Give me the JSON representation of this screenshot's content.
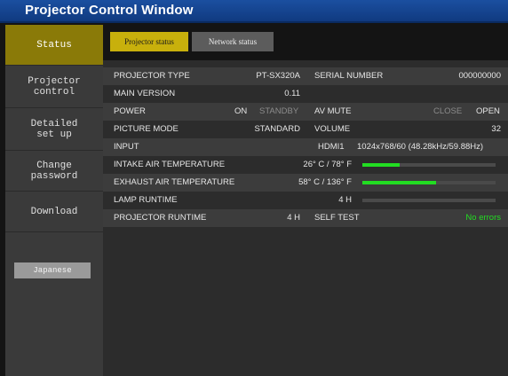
{
  "window": {
    "title": "Projector Control Window"
  },
  "sidebar": {
    "items": [
      {
        "label": "Status",
        "active": true
      },
      {
        "label": "Projector\ncontrol",
        "active": false
      },
      {
        "label": "Detailed\nset up",
        "active": false
      },
      {
        "label": "Change\npassword",
        "active": false
      },
      {
        "label": "Download",
        "active": false
      }
    ],
    "language_button": "Japanese"
  },
  "tabs": [
    {
      "label": "Projector status",
      "active": true
    },
    {
      "label": "Network status",
      "active": false
    }
  ],
  "status": {
    "projector_type": {
      "label": "PROJECTOR TYPE",
      "value": "PT-SX320A"
    },
    "serial_number": {
      "label": "SERIAL NUMBER",
      "value": "000000000"
    },
    "main_version": {
      "label": "MAIN VERSION",
      "value": "0.11"
    },
    "power": {
      "label": "POWER",
      "on": "ON",
      "standby": "STANDBY",
      "current": "ON"
    },
    "av_mute": {
      "label": "AV MUTE",
      "close": "CLOSE",
      "open": "OPEN",
      "current": "OPEN"
    },
    "picture_mode": {
      "label": "PICTURE MODE",
      "value": "STANDARD"
    },
    "volume": {
      "label": "VOLUME",
      "value": "32"
    },
    "input": {
      "label": "INPUT",
      "value": "HDMI1",
      "signal": "1024x768/60 (48.28kHz/59.88Hz)"
    },
    "intake_air_temperature": {
      "label": "INTAKE AIR TEMPERATURE",
      "value": "26° C / 78° F",
      "level": 0.28
    },
    "exhaust_air_temperature": {
      "label": "EXHAUST AIR TEMPERATURE",
      "value": "58° C / 136° F",
      "level": 0.55
    },
    "lamp_runtime": {
      "label": "LAMP RUNTIME",
      "value": "4 H",
      "level": 0.0
    },
    "projector_runtime": {
      "label": "PROJECTOR RUNTIME",
      "value": "4 H"
    },
    "self_test": {
      "label": "SELF TEST",
      "value": "No errors"
    }
  },
  "colors": {
    "title_bar": "#1b4fa0",
    "nav_active": "#8a7a08",
    "tab_active": "#c8b00c",
    "ok_green": "#22dd22"
  }
}
